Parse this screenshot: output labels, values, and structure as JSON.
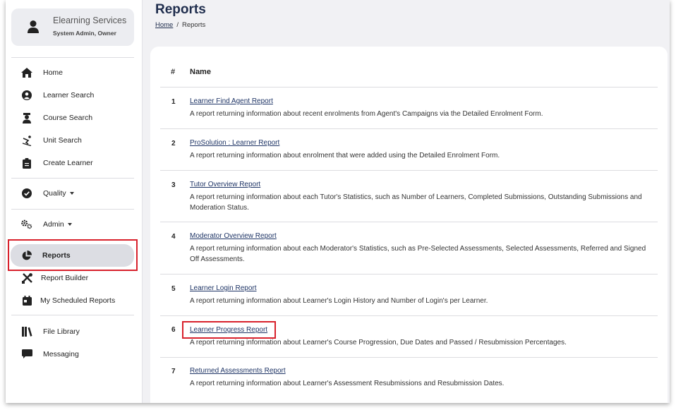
{
  "user": {
    "name": "Elearning Services",
    "role": "System Admin, Owner",
    "icon": "user-icon"
  },
  "sidebar": {
    "items": [
      {
        "label": "Home",
        "icon": "home-icon"
      },
      {
        "label": "Learner Search",
        "icon": "user-circle-icon"
      },
      {
        "label": "Course Search",
        "icon": "graduate-icon"
      },
      {
        "label": "Unit Search",
        "icon": "skiing-icon"
      },
      {
        "label": "Create Learner",
        "icon": "clipboard-icon"
      },
      {
        "label": "Quality",
        "icon": "check-circle-icon"
      },
      {
        "label": "Admin",
        "icon": "gears-icon"
      },
      {
        "label": "Reports",
        "icon": "pie-chart-icon"
      },
      {
        "label": "Report Builder",
        "icon": "tools-icon"
      },
      {
        "label": "My Scheduled Reports",
        "icon": "calendar-icon"
      },
      {
        "label": "File Library",
        "icon": "books-icon"
      },
      {
        "label": "Messaging",
        "icon": "message-icon"
      }
    ]
  },
  "header": {
    "title": "Reports",
    "breadcrumb": {
      "home": "Home",
      "separator": "/",
      "current": "Reports"
    }
  },
  "table": {
    "headers": {
      "num": "#",
      "name": "Name"
    },
    "rows": [
      {
        "num": "1",
        "title": "Learner Find Agent Report",
        "desc": "A report returning information about recent enrolments from Agent's Campaigns via the Detailed Enrolment Form."
      },
      {
        "num": "2",
        "title": "ProSolution : Learner Report",
        "desc": "A report returning information about enrolment that were added using the Detailed Enrolment Form."
      },
      {
        "num": "3",
        "title": "Tutor Overview Report",
        "desc": "A report returning information about each Tutor's Statistics, such as Number of Learners, Completed Submissions, Outstanding Submissions and Moderation Status."
      },
      {
        "num": "4",
        "title": "Moderator Overview Report",
        "desc": "A report returning information about each Moderator's Statistics, such as Pre-Selected Assessments, Selected Assessments, Referred and Signed Off Assessments."
      },
      {
        "num": "5",
        "title": "Learner Login Report",
        "desc": "A report returning information about Learner's Login History and Number of Login's per Learner."
      },
      {
        "num": "6",
        "title": "Learner Progress Report",
        "desc": "A report returning information about Learner's Course Progression, Due Dates and Passed / Resubmission Percentages."
      },
      {
        "num": "7",
        "title": "Returned Assessments Report",
        "desc": "A report returning information about Learner's Assessment Resubmissions and Resubmission Dates."
      }
    ]
  },
  "colors": {
    "accent": "#1f2d4d",
    "highlight": "#d8212c",
    "active_bg": "#dcdde3",
    "page_bg": "#f1f1f4"
  }
}
